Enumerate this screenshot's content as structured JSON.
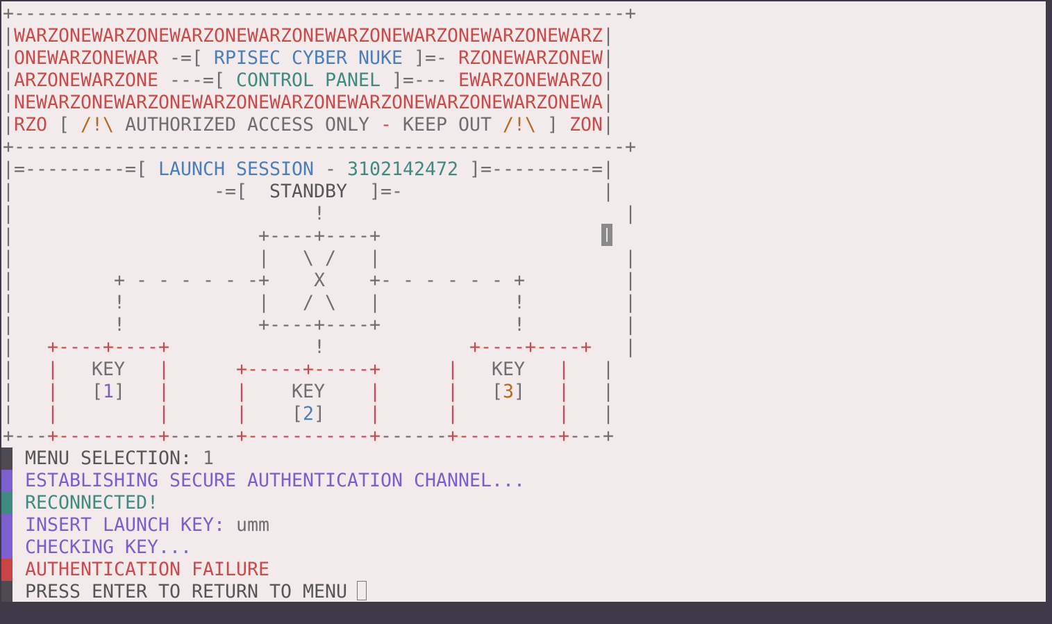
{
  "banner": {
    "l0": "+-------------------------------------------------------+",
    "l1": "WARZONEWARZONEWARZONEWARZONEWARZONEWARZONEWARZONEWARZ",
    "l2a": "ONEWARZONEWAR",
    "l2b": " -=[ ",
    "l2c": "RPISEC CYBER NUKE",
    "l2d": " ]=- ",
    "l2e": "RZONEWARZONEW",
    "l3a": "ARZONEWARZONE",
    "l3b": " ---=[ ",
    "l3c": "CONTROL PANEL",
    "l3d": " ]=--- ",
    "l3e": "EWARZONEWARZO",
    "l4": "NEWARZONEWARZONEWARZONEWARZONEWARZONEWARZONEWARZONEWA",
    "l5a": "RZO",
    "l5b": " [ ",
    "l5c": "/!\\",
    "l5d": " AUTHORIZED ACCESS ONLY ",
    "l5e": "-",
    "l5f": " KEEP OUT ",
    "l5g": "/!\\",
    "l5h": " ] ",
    "l5i": "ZON",
    "l6": "+-------------------------------------------------------+"
  },
  "session": {
    "left": "|=---------=[ ",
    "label": "LAUNCH SESSION",
    "dash": " - ",
    "id": "3102142472",
    "right": " ]=---------=|",
    "status_pre": "|                  -=[  ",
    "status": "STANDBY",
    "status_post": "  ]=-                  |"
  },
  "diagram": {
    "r1": "|                           !                           |",
    "r2": "|                      +----+----+                      ",
    "r3": "|                      |   \\ /   |                      |",
    "r4": "|         + - - - - - -+    X    +- - - - - - +         |",
    "r5": "|         !            |   / \\   |            !         |",
    "r6": "|         !            +----+----+            !         |",
    "r7a": "|   ",
    "r7b": "+----+----+",
    "r7c": "             !             ",
    "r7d": "+----+----+",
    "r7e": "   |",
    "r8a": "|   ",
    "r8b": "|",
    "r8c": "   KEY   ",
    "r8d": "|",
    "r8e": "      ",
    "r8f": "+-----+-----+",
    "r8g": "      ",
    "r8h": "|",
    "r8i": "   KEY   ",
    "r8j": "|",
    "r8k": "   |",
    "r9a": "|   ",
    "r9b": "|",
    "r9c": "   [",
    "r9d": "1",
    "r9e": "]   ",
    "r9f": "|",
    "r9g": "      ",
    "r9h": "|",
    "r9i": "    KEY    ",
    "r9j": "|",
    "r9k": "      ",
    "r9l": "|",
    "r9m": "   [",
    "r9n": "3",
    "r9o": "]   ",
    "r9p": "|",
    "r9q": "   |",
    "r10a": "|   ",
    "r10b": "|",
    "r10c": "         ",
    "r10d": "|",
    "r10e": "      ",
    "r10f": "|",
    "r10g": "    [",
    "r10h": "2",
    "r10i": "]    ",
    "r10j": "|",
    "r10k": "      ",
    "r10l": "|",
    "r10m": "         ",
    "r10n": "|",
    "r10o": "   |",
    "r11a": "+---",
    "r11b": "+---------+",
    "r11c": "------",
    "r11d": "+-----------+",
    "r11e": "------",
    "r11f": "+---------+",
    "r11g": "---+"
  },
  "output": {
    "menu_label": "MENU SELECTION: ",
    "menu_value": "1",
    "establishing": "ESTABLISHING SECURE AUTHENTICATION CHANNEL...",
    "reconnected": "RECONNECTED!",
    "insert_label": "INSERT LAUNCH KEY: ",
    "insert_value": "umm",
    "checking": "CHECKING KEY...",
    "failure": "AUTHENTICATION FAILURE",
    "press_enter": "PRESS ENTER TO RETURN TO MENU "
  },
  "colors": {
    "background": "#f2eaeb",
    "red": "#c94a4a",
    "blue": "#4a7eb8",
    "teal": "#3f8a80",
    "purple": "#7a5ec9",
    "orange": "#b8681f"
  }
}
